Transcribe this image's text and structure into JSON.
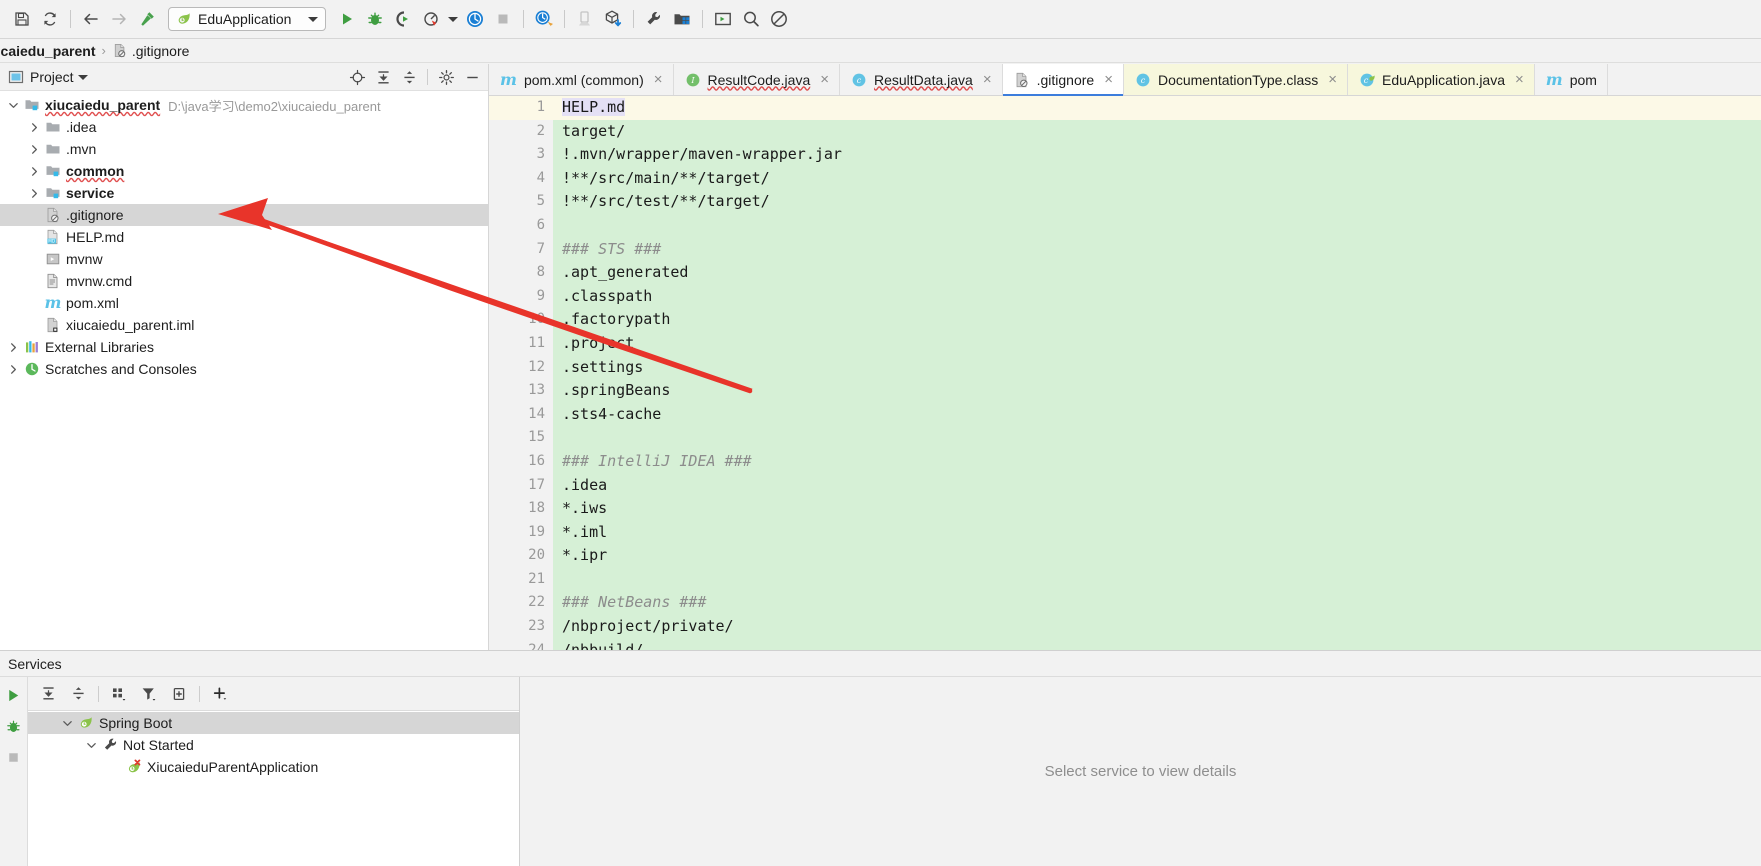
{
  "toolbar": {
    "icons_left": [
      {
        "name": "save-all-icon",
        "title": "Save All"
      },
      {
        "name": "sync-refresh-icon",
        "title": "Synchronize"
      },
      {
        "name": "back-arrow-icon",
        "title": "Back"
      },
      {
        "name": "forward-arrow-icon",
        "title": "Forward"
      },
      {
        "name": "compile-hammer-icon",
        "title": "Build Project"
      }
    ],
    "run_config": {
      "label": "EduApplication",
      "icon": "spring-boot-icon",
      "dropdown": "chevron-down-icon"
    },
    "icons_right": [
      {
        "name": "run-icon",
        "title": "Run"
      },
      {
        "name": "debug-icon",
        "title": "Debug"
      },
      {
        "name": "run-coverage-icon",
        "title": "Run with Coverage"
      },
      {
        "name": "profiler-icon",
        "title": "Profiler"
      },
      {
        "name": "profiler-dropdown-icon",
        "title": "Profiler options"
      },
      {
        "name": "update-application-icon",
        "title": "Update Application"
      },
      {
        "name": "stop-icon",
        "title": "Stop"
      },
      {
        "name": "attach-debugger-icon",
        "title": "Attach to Process"
      },
      {
        "name": "device-manager-icon",
        "title": "Device Manager"
      },
      {
        "name": "package-download-icon",
        "title": "Download Sources"
      },
      {
        "name": "settings-wrench-icon",
        "title": "Settings"
      },
      {
        "name": "project-structure-icon",
        "title": "Project Structure"
      },
      {
        "name": "terminal-window-icon",
        "title": "Terminal"
      },
      {
        "name": "search-everywhere-icon",
        "title": "Search Everywhere"
      },
      {
        "name": "no-access-icon",
        "title": "Disabled"
      }
    ]
  },
  "navbar": {
    "crumbs": [
      {
        "label": "ucaiedu_parent",
        "icon": "none",
        "bold": true
      },
      {
        "label": ".gitignore",
        "icon": "gitignore-file-icon",
        "bold": false
      }
    ],
    "separator": "›"
  },
  "project_panel": {
    "title": "Project",
    "dropdown_icon": "chevron-down-icon",
    "actions": [
      {
        "name": "select-opened-file-icon",
        "title": "Select Opened File"
      },
      {
        "name": "expand-all-icon",
        "title": "Expand All"
      },
      {
        "name": "collapse-all-icon",
        "title": "Collapse All"
      },
      {
        "name": "gear-icon",
        "title": "Options"
      },
      {
        "name": "hide-icon",
        "title": "Hide"
      }
    ],
    "tree": [
      {
        "label": "xiucaiedu_parent",
        "path": "D:\\java学习\\demo2\\xiucaiedu_parent",
        "icon": "module-folder-icon",
        "arrow": "expanded",
        "indent": 0,
        "bold": true,
        "selected": false,
        "squiggle": true
      },
      {
        "label": ".idea",
        "path": "",
        "icon": "folder-icon",
        "arrow": "collapsed",
        "indent": 1,
        "bold": false,
        "selected": false,
        "squiggle": false
      },
      {
        "label": ".mvn",
        "path": "",
        "icon": "folder-icon",
        "arrow": "collapsed",
        "indent": 1,
        "bold": false,
        "selected": false,
        "squiggle": false
      },
      {
        "label": "common",
        "path": "",
        "icon": "module-folder-icon",
        "arrow": "collapsed",
        "indent": 1,
        "bold": true,
        "selected": false,
        "squiggle": true
      },
      {
        "label": "service",
        "path": "",
        "icon": "module-folder-icon",
        "arrow": "collapsed",
        "indent": 1,
        "bold": true,
        "selected": false,
        "squiggle": false
      },
      {
        "label": ".gitignore",
        "path": "",
        "icon": "gitignore-file-icon",
        "arrow": "none",
        "indent": 1,
        "bold": false,
        "selected": true,
        "squiggle": false
      },
      {
        "label": "HELP.md",
        "path": "",
        "icon": "markdown-file-icon",
        "arrow": "none",
        "indent": 1,
        "bold": false,
        "selected": false,
        "squiggle": false
      },
      {
        "label": "mvnw",
        "path": "",
        "icon": "script-file-icon",
        "arrow": "none",
        "indent": 1,
        "bold": false,
        "selected": false,
        "squiggle": false
      },
      {
        "label": "mvnw.cmd",
        "path": "",
        "icon": "text-file-icon",
        "arrow": "none",
        "indent": 1,
        "bold": false,
        "selected": false,
        "squiggle": false
      },
      {
        "label": "pom.xml",
        "path": "",
        "icon": "maven-file-icon",
        "arrow": "none",
        "indent": 1,
        "bold": false,
        "selected": false,
        "squiggle": false
      },
      {
        "label": "xiucaiedu_parent.iml",
        "path": "",
        "icon": "iml-file-icon",
        "arrow": "none",
        "indent": 1,
        "bold": false,
        "selected": false,
        "squiggle": false
      },
      {
        "label": "External Libraries",
        "path": "",
        "icon": "libraries-icon",
        "arrow": "collapsed",
        "indent": 0,
        "bold": false,
        "selected": false,
        "squiggle": false
      },
      {
        "label": "Scratches and Consoles",
        "path": "",
        "icon": "scratches-icon",
        "arrow": "collapsed",
        "indent": 0,
        "bold": false,
        "selected": false,
        "squiggle": false
      }
    ]
  },
  "editor": {
    "tabs": [
      {
        "label": "pom.xml (common)",
        "icon": "maven-file-icon",
        "active": false,
        "tinted": false,
        "closable": true,
        "error": false
      },
      {
        "label": "ResultCode.java",
        "icon": "java-interface-icon",
        "active": false,
        "tinted": false,
        "closable": true,
        "error": true
      },
      {
        "label": "ResultData.java",
        "icon": "java-class-icon",
        "active": false,
        "tinted": false,
        "closable": true,
        "error": true
      },
      {
        "label": ".gitignore",
        "icon": "gitignore-file-icon",
        "active": true,
        "tinted": false,
        "closable": true,
        "error": false
      },
      {
        "label": "DocumentationType.class",
        "icon": "java-class-icon",
        "active": false,
        "tinted": true,
        "closable": true,
        "error": false
      },
      {
        "label": "EduApplication.java",
        "icon": "spring-class-icon",
        "active": false,
        "tinted": true,
        "closable": true,
        "error": false
      },
      {
        "label": "pom",
        "icon": "maven-file-icon",
        "active": false,
        "tinted": false,
        "closable": false,
        "error": false
      }
    ],
    "lines": [
      {
        "n": 1,
        "text": "HELP.md",
        "state": "current",
        "fold": false,
        "comment": false,
        "selected": true
      },
      {
        "n": 2,
        "text": "target/",
        "state": "added",
        "fold": true,
        "comment": false,
        "selected": false
      },
      {
        "n": 3,
        "text": "!.mvn/wrapper/maven-wrapper.jar",
        "state": "added",
        "fold": false,
        "comment": false,
        "selected": false
      },
      {
        "n": 4,
        "text": "!**/src/main/**/target/",
        "state": "added",
        "fold": true,
        "comment": false,
        "selected": false
      },
      {
        "n": 5,
        "text": "!**/src/test/**/target/",
        "state": "added",
        "fold": true,
        "comment": false,
        "selected": false
      },
      {
        "n": 6,
        "text": "",
        "state": "added",
        "fold": false,
        "comment": false,
        "selected": false
      },
      {
        "n": 7,
        "text": "### STS ###",
        "state": "added",
        "fold": false,
        "comment": true,
        "selected": false
      },
      {
        "n": 8,
        "text": ".apt_generated",
        "state": "added",
        "fold": false,
        "comment": false,
        "selected": false
      },
      {
        "n": 9,
        "text": ".classpath",
        "state": "added",
        "fold": false,
        "comment": false,
        "selected": false
      },
      {
        "n": 10,
        "text": ".factorypath",
        "state": "added",
        "fold": false,
        "comment": false,
        "selected": false
      },
      {
        "n": 11,
        "text": ".project",
        "state": "added",
        "fold": false,
        "comment": false,
        "selected": false
      },
      {
        "n": 12,
        "text": ".settings",
        "state": "added",
        "fold": false,
        "comment": false,
        "selected": false
      },
      {
        "n": 13,
        "text": ".springBeans",
        "state": "added",
        "fold": false,
        "comment": false,
        "selected": false
      },
      {
        "n": 14,
        "text": ".sts4-cache",
        "state": "added",
        "fold": false,
        "comment": false,
        "selected": false
      },
      {
        "n": 15,
        "text": "",
        "state": "added",
        "fold": false,
        "comment": false,
        "selected": false
      },
      {
        "n": 16,
        "text": "### IntelliJ IDEA ###",
        "state": "added",
        "fold": false,
        "comment": true,
        "selected": false
      },
      {
        "n": 17,
        "text": ".idea",
        "state": "added",
        "fold": true,
        "comment": false,
        "selected": false
      },
      {
        "n": 18,
        "text": "*.iws",
        "state": "added",
        "fold": false,
        "comment": false,
        "selected": false
      },
      {
        "n": 19,
        "text": "*.iml",
        "state": "added",
        "fold": false,
        "comment": false,
        "selected": false
      },
      {
        "n": 20,
        "text": "*.ipr",
        "state": "added",
        "fold": false,
        "comment": false,
        "selected": false
      },
      {
        "n": 21,
        "text": "",
        "state": "added",
        "fold": false,
        "comment": false,
        "selected": false
      },
      {
        "n": 22,
        "text": "### NetBeans ###",
        "state": "added",
        "fold": false,
        "comment": true,
        "selected": false
      },
      {
        "n": 23,
        "text": "/nbproject/private/",
        "state": "added",
        "fold": true,
        "comment": false,
        "selected": false
      },
      {
        "n": 24,
        "text": "/nbbuild/",
        "state": "added",
        "fold": true,
        "comment": false,
        "selected": false
      }
    ]
  },
  "services": {
    "title": "Services",
    "left_actions": [
      {
        "name": "run-service-icon",
        "title": "Run"
      },
      {
        "name": "debug-service-icon",
        "title": "Debug"
      },
      {
        "name": "stop-service-icon",
        "title": "Stop"
      }
    ],
    "actions": [
      {
        "name": "expand-all-icon",
        "title": "Expand All"
      },
      {
        "name": "collapse-all-icon",
        "title": "Collapse All"
      },
      {
        "name": "group-by-icon",
        "title": "Group By"
      },
      {
        "name": "filter-icon",
        "title": "Filter"
      },
      {
        "name": "add-tab-icon",
        "title": "Show in New Tab"
      },
      {
        "name": "add-service-icon",
        "title": "Add Service"
      }
    ],
    "tree": [
      {
        "label": "Spring Boot",
        "icon": "spring-boot-icon",
        "arrow": "expanded",
        "indent": 1,
        "selected": true
      },
      {
        "label": "Not Started",
        "icon": "wrench-icon",
        "arrow": "expanded",
        "indent": 2,
        "selected": false
      },
      {
        "label": "XiucaieduParentApplication",
        "icon": "spring-app-error-icon",
        "arrow": "none",
        "indent": 3,
        "selected": false
      }
    ],
    "detail_message": "Select service to view details"
  },
  "annotation": {
    "arrow_color": "#e8342a",
    "description": "red-arrow-pointing-to-gitignore-tree-item"
  },
  "colors": {
    "accent_blue": "#3c7ddc",
    "vcs_added_green": "#d6f0d6",
    "current_line": "#fcf9e7",
    "selection_lilac": "#e4e0f5",
    "tab_tint": "#f7f7dc",
    "selection_gray": "#d6d6d6"
  }
}
